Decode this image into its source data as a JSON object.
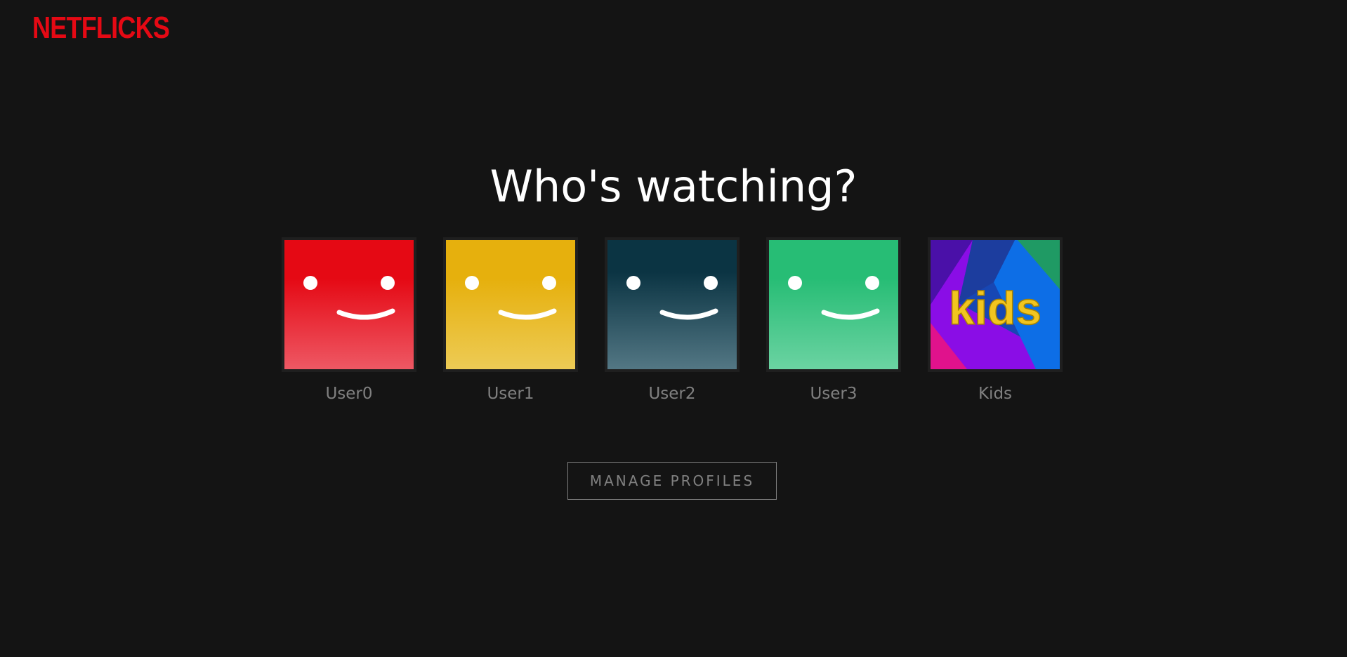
{
  "header": {
    "logo_text": "NETFLICKS",
    "brand_color": "#e50914"
  },
  "main": {
    "title": "Who's watching?",
    "manage_button_label": "MANAGE PROFILES"
  },
  "profiles": [
    {
      "name": "User0",
      "icon": "smiley-avatar",
      "color_top": "#e50914",
      "color_bottom": "#ee5864"
    },
    {
      "name": "User1",
      "icon": "smiley-avatar",
      "color_top": "#e6b00d",
      "color_bottom": "#edcb55"
    },
    {
      "name": "User2",
      "icon": "smiley-avatar",
      "color_top": "#0b3443",
      "color_bottom": "#537784"
    },
    {
      "name": "User3",
      "icon": "smiley-avatar",
      "color_top": "#27bd75",
      "color_bottom": "#6bd3a2"
    },
    {
      "name": "Kids",
      "icon": "kids-avatar",
      "avatar_text": "kids"
    }
  ]
}
